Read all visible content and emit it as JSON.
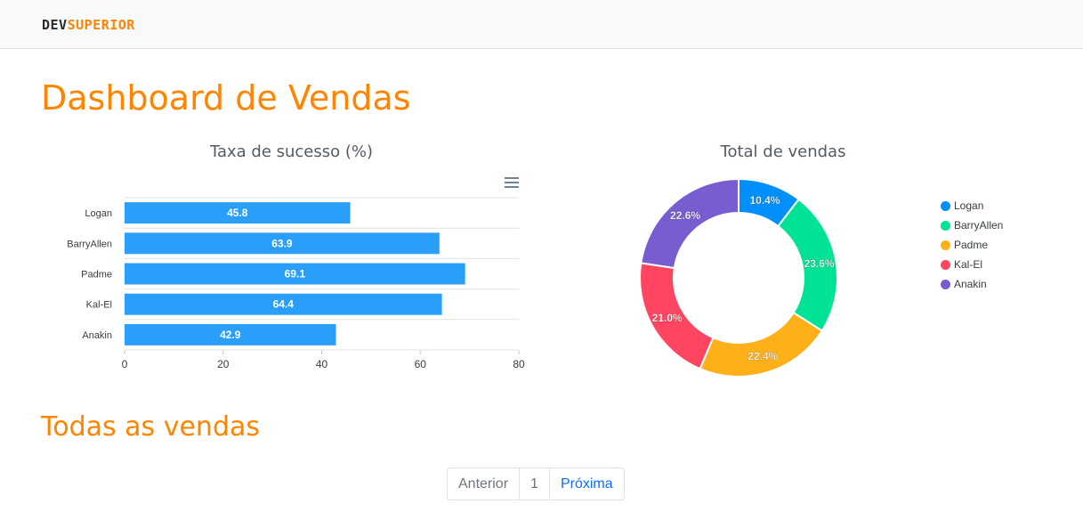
{
  "navbar": {
    "brand_dev": "DEV",
    "brand_superior": "SUPERIOR"
  },
  "page_title": "Dashboard de Vendas",
  "section_title": "Todas as vendas",
  "colors": {
    "accent": "#ff8400",
    "bar": "#2a9ffa",
    "grid": "#e0e0e0"
  },
  "chart_data": [
    {
      "type": "bar",
      "orientation": "horizontal",
      "title": "Taxa de sucesso (%)",
      "categories": [
        "Logan",
        "BarryAllen",
        "Padme",
        "Kal-El",
        "Anakin"
      ],
      "values": [
        45.8,
        63.9,
        69.1,
        64.4,
        42.9
      ],
      "data_labels": [
        "45.8",
        "63.9",
        "69.1",
        "64.4",
        "42.9"
      ],
      "xlim": [
        0,
        80
      ],
      "xticks": [
        "0",
        "20",
        "40",
        "60",
        "80"
      ],
      "grid": true,
      "color": "#2a9ffa",
      "menu_icon": "hamburger-menu-icon"
    },
    {
      "type": "pie",
      "variant": "donut",
      "title": "Total de vendas",
      "labels": [
        "Logan",
        "BarryAllen",
        "Padme",
        "Kal-El",
        "Anakin"
      ],
      "values": [
        10.4,
        23.6,
        22.4,
        21.0,
        22.6
      ],
      "data_labels": [
        "10.4%",
        "23.6%",
        "22.4%",
        "21.0%",
        "22.6%"
      ],
      "colors": [
        "#008ffb",
        "#00e396",
        "#feb019",
        "#ff4560",
        "#775dd0"
      ],
      "legend": "right"
    }
  ],
  "pagination": {
    "previous": "Anterior",
    "current": "1",
    "next": "Próxima"
  }
}
